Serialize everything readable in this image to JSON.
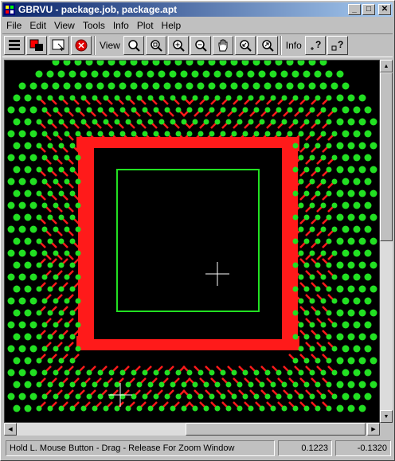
{
  "window": {
    "title": "GBRVU - package.job, package.apt"
  },
  "window_buttons": {
    "minimize": "_",
    "maximize": "□",
    "close": "✕"
  },
  "menu": [
    "File",
    "Edit",
    "View",
    "Tools",
    "Info",
    "Plot",
    "Help"
  ],
  "toolbar": {
    "view_label": "View",
    "info_label": "Info",
    "buttons": [
      {
        "icon": "layers-icon"
      },
      {
        "icon": "color-palette-icon"
      },
      {
        "icon": "select-window-icon"
      },
      {
        "icon": "stop-icon"
      },
      {
        "icon": "zoom-icon"
      },
      {
        "icon": "zoom-all-icon"
      },
      {
        "icon": "zoom-in-icon"
      },
      {
        "icon": "zoom-out-icon"
      },
      {
        "icon": "pan-hand-icon"
      },
      {
        "icon": "zoom-previous-icon"
      },
      {
        "icon": "zoom-fit-icon"
      },
      {
        "icon": "info-point-icon"
      },
      {
        "icon": "info-area-icon"
      }
    ]
  },
  "canvas": {
    "background": "#000000",
    "pad_color": "#22e022",
    "trace_color": "#ff1a1a",
    "outline_color": "#22e022",
    "cursor_color": "#ffffff"
  },
  "status": {
    "message": "Hold L. Mouse Button - Drag - Release For Zoom Window",
    "x": "0.1223",
    "y": "-0.1320"
  }
}
